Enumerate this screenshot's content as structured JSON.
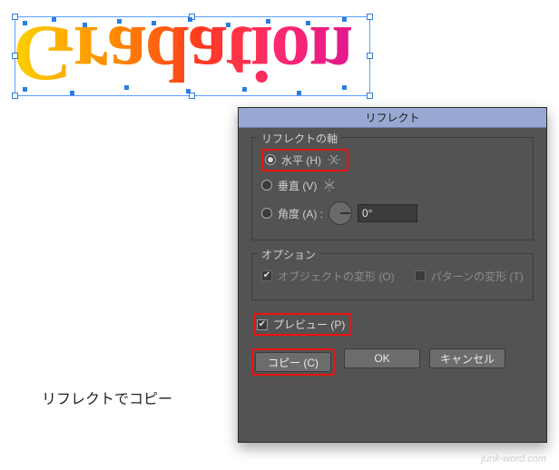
{
  "artwork": {
    "text": "Gradation"
  },
  "caption": "リフレクトでコピー",
  "watermark": "junk-word.com",
  "dialog": {
    "title": "リフレクト",
    "axis": {
      "legend": "リフレクトの軸",
      "horizontal": {
        "label": "水平 (H)",
        "checked": true
      },
      "vertical": {
        "label": "垂直 (V)",
        "checked": false
      },
      "angle": {
        "label": "角度 (A) :",
        "value": "0°",
        "checked": false
      }
    },
    "options": {
      "legend": "オプション",
      "transform_objects": {
        "label": "オブジェクトの変形 (O)",
        "checked": true,
        "enabled": false
      },
      "transform_patterns": {
        "label": "パターンの変形 (T)",
        "checked": false,
        "enabled": false
      }
    },
    "preview": {
      "label": "プレビュー (P)",
      "checked": true
    },
    "buttons": {
      "copy": "コピー (C)",
      "ok": "OK",
      "cancel": "キャンセル"
    }
  }
}
